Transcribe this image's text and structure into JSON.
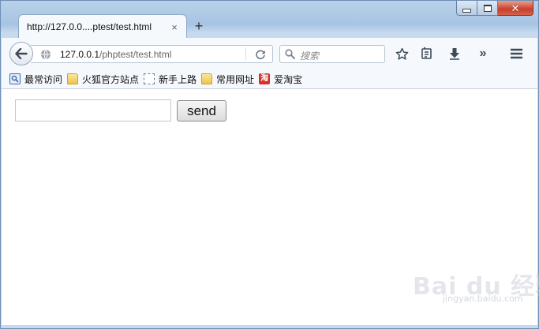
{
  "tab": {
    "title": "http://127.0.0....ptest/test.html",
    "close": "×"
  },
  "new_tab_label": "+",
  "nav": {
    "url_host": "127.0.0.1",
    "url_path": "/phptest/test.html",
    "search_placeholder": "搜索"
  },
  "bookmarks": [
    {
      "label": "最常访问",
      "icon": "most-visited-icon"
    },
    {
      "label": "火狐官方站点",
      "icon": "folder-icon"
    },
    {
      "label": "新手上路",
      "icon": "dashed-page-icon"
    },
    {
      "label": "常用网址",
      "icon": "folder-icon"
    },
    {
      "label": "爱淘宝",
      "icon": "taobao-icon",
      "glyph": "淘"
    }
  ],
  "page": {
    "input_value": "",
    "send_label": "send"
  },
  "watermark": {
    "text": "Bai du 经验",
    "sub": "jingyan.baidu.com"
  },
  "colors": {
    "frame": "#b9d1ea",
    "toolbar": "#f5f8fc",
    "close_button": "#c8402a"
  }
}
